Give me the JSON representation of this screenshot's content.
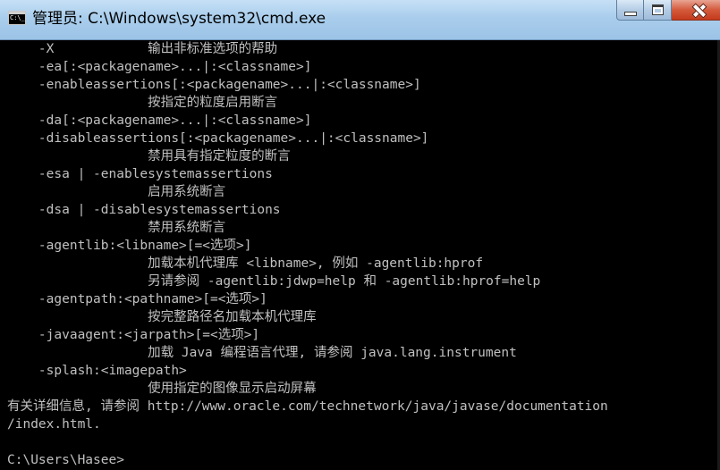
{
  "window": {
    "title": "管理员: C:\\Windows\\system32\\cmd.exe",
    "controls": {
      "minimize": "minimize",
      "maximize": "maximize",
      "close": "close"
    }
  },
  "console": {
    "text_color": "#c0c0c0",
    "background": "#000000",
    "lines": [
      "    -X            输出非标准选项的帮助",
      "    -ea[:<packagename>...|:<classname>]",
      "    -enableassertions[:<packagename>...|:<classname>]",
      "                  按指定的粒度启用断言",
      "    -da[:<packagename>...|:<classname>]",
      "    -disableassertions[:<packagename>...|:<classname>]",
      "                  禁用具有指定粒度的断言",
      "    -esa | -enablesystemassertions",
      "                  启用系统断言",
      "    -dsa | -disablesystemassertions",
      "                  禁用系统断言",
      "    -agentlib:<libname>[=<选项>]",
      "                  加载本机代理库 <libname>, 例如 -agentlib:hprof",
      "                  另请参阅 -agentlib:jdwp=help 和 -agentlib:hprof=help",
      "    -agentpath:<pathname>[=<选项>]",
      "                  按完整路径名加载本机代理库",
      "    -javaagent:<jarpath>[=<选项>]",
      "                  加载 Java 编程语言代理, 请参阅 java.lang.instrument",
      "    -splash:<imagepath>",
      "                  使用指定的图像显示启动屏幕",
      "有关详细信息, 请参阅 http://www.oracle.com/technetwork/java/javase/documentation",
      "/index.html.",
      "",
      "C:\\Users\\Hasee>"
    ]
  }
}
